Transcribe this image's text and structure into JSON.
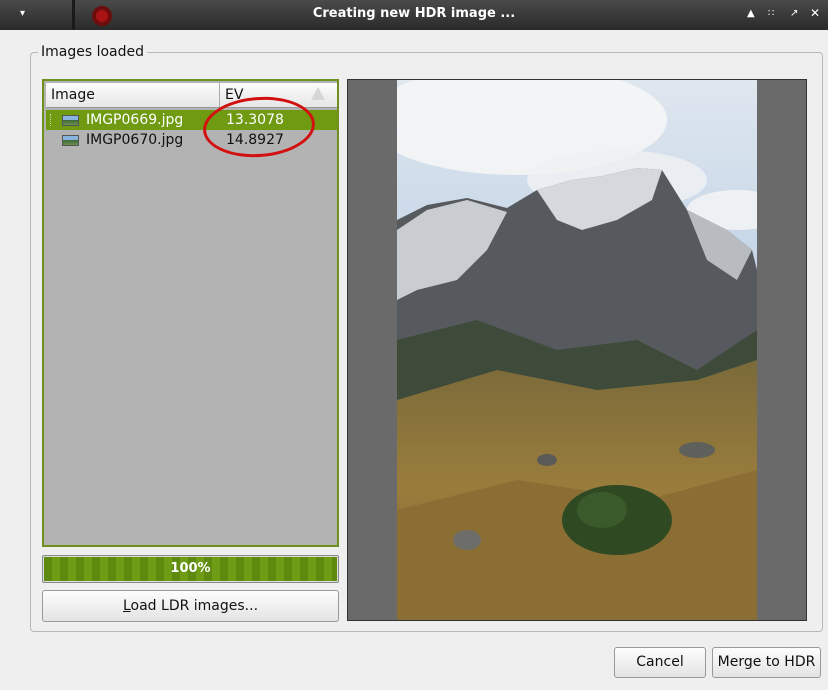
{
  "window": {
    "title": "Creating new HDR image ...",
    "menu_icon": "▾",
    "controls": {
      "menu": "▲",
      "minimize": "∷",
      "maximize": "↗",
      "close": "✕"
    }
  },
  "group": {
    "title": "Images loaded"
  },
  "table": {
    "columns": [
      "Image",
      "EV"
    ],
    "rows": [
      {
        "file": "IMGP0669.jpg",
        "ev": "13.3078",
        "selected": true
      },
      {
        "file": "IMGP0670.jpg",
        "ev": "14.8927",
        "selected": false
      }
    ]
  },
  "progress": {
    "text": "100%",
    "value": 1.0
  },
  "buttons": {
    "load_mnemonic": "L",
    "load_rest": "oad LDR images...",
    "cancel": "Cancel",
    "merge": "Merge to HDR"
  },
  "colors": {
    "accent": "#6f9a12",
    "annotation": "#d31010",
    "list_background": "#b3b3b3"
  },
  "icons": {
    "app_logo": "app-logo-icon",
    "sort": "sort-ascending-icon",
    "file_thumbnail": "image-file-icon"
  }
}
